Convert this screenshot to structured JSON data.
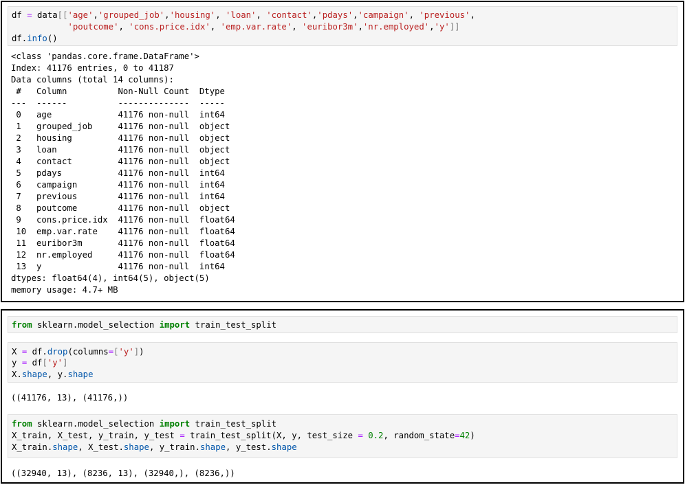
{
  "cell1": {
    "code_lines": [
      "df = data[['age','grouped_job','housing', 'loan', 'contact','pdays','campaign', 'previous',",
      "           'poutcome', 'cons.price.idx', 'emp.var.rate', 'euribor3m','nr.employed','y']]",
      "df.info()"
    ],
    "output_header": [
      "<class 'pandas.core.frame.DataFrame'>",
      "Index: 41176 entries, 0 to 41187",
      "Data columns (total 14 columns):",
      " #   Column          Non-Null Count  Dtype  ",
      "---  ------          --------------  -----  "
    ],
    "info_rows": [
      {
        "idx": "0",
        "column": "age",
        "count": "41176 non-null",
        "dtype": "int64"
      },
      {
        "idx": "1",
        "column": "grouped_job",
        "count": "41176 non-null",
        "dtype": "object"
      },
      {
        "idx": "2",
        "column": "housing",
        "count": "41176 non-null",
        "dtype": "object"
      },
      {
        "idx": "3",
        "column": "loan",
        "count": "41176 non-null",
        "dtype": "object"
      },
      {
        "idx": "4",
        "column": "contact",
        "count": "41176 non-null",
        "dtype": "object"
      },
      {
        "idx": "5",
        "column": "pdays",
        "count": "41176 non-null",
        "dtype": "int64"
      },
      {
        "idx": "6",
        "column": "campaign",
        "count": "41176 non-null",
        "dtype": "int64"
      },
      {
        "idx": "7",
        "column": "previous",
        "count": "41176 non-null",
        "dtype": "int64"
      },
      {
        "idx": "8",
        "column": "poutcome",
        "count": "41176 non-null",
        "dtype": "object"
      },
      {
        "idx": "9",
        "column": "cons.price.idx",
        "count": "41176 non-null",
        "dtype": "float64"
      },
      {
        "idx": "10",
        "column": "emp.var.rate",
        "count": "41176 non-null",
        "dtype": "float64"
      },
      {
        "idx": "11",
        "column": "euribor3m",
        "count": "41176 non-null",
        "dtype": "float64"
      },
      {
        "idx": "12",
        "column": "nr.employed",
        "count": "41176 non-null",
        "dtype": "float64"
      },
      {
        "idx": "13",
        "column": "y",
        "count": "41176 non-null",
        "dtype": "int64"
      }
    ],
    "output_footer": [
      "dtypes: float64(4), int64(5), object(5)",
      "memory usage: 4.7+ MB"
    ]
  },
  "cell2": {
    "code_lines": [
      "from sklearn.model_selection import train_test_split"
    ]
  },
  "cell3": {
    "code_lines": [
      "X = df.drop(columns=['y'])",
      "y = df['y']",
      "X.shape, y.shape"
    ],
    "output": "((41176, 13), (41176,))"
  },
  "cell4": {
    "code_lines": [
      "from sklearn.model_selection import train_test_split",
      "X_train, X_test, y_train, y_test = train_test_split(X, y, test_size = 0.2, random_state=42)",
      "X_train.shape, X_test.shape, y_train.shape, y_test.shape"
    ],
    "output": "((32940, 13), (8236, 13), (32940,), (8236,))"
  }
}
